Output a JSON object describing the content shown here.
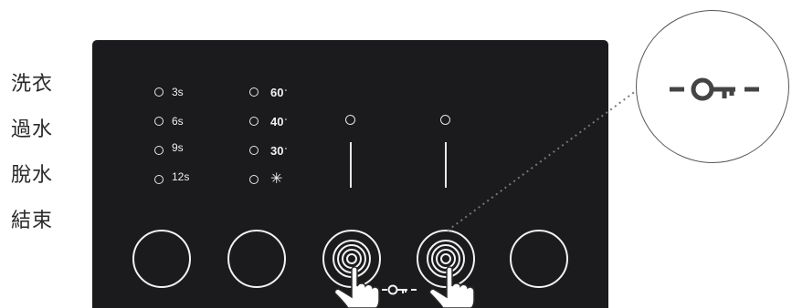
{
  "stage_labels": [
    "洗衣",
    "過水",
    "脫水",
    "結束"
  ],
  "time_options": [
    "3s",
    "6s",
    "9s",
    "12s"
  ],
  "temp_options": [
    {
      "label": "60",
      "unit": "°"
    },
    {
      "label": "40",
      "unit": "°"
    },
    {
      "label": "30",
      "unit": "°"
    }
  ],
  "cold_symbol": "✳",
  "icons": {
    "lock": "key-lock-icon",
    "touch": "finger-press-icon"
  },
  "colors": {
    "panel": "#1b1a1d",
    "indicator": "#e8e8e8",
    "text": "#2a2a2a",
    "dotted_leader": "#777777"
  }
}
